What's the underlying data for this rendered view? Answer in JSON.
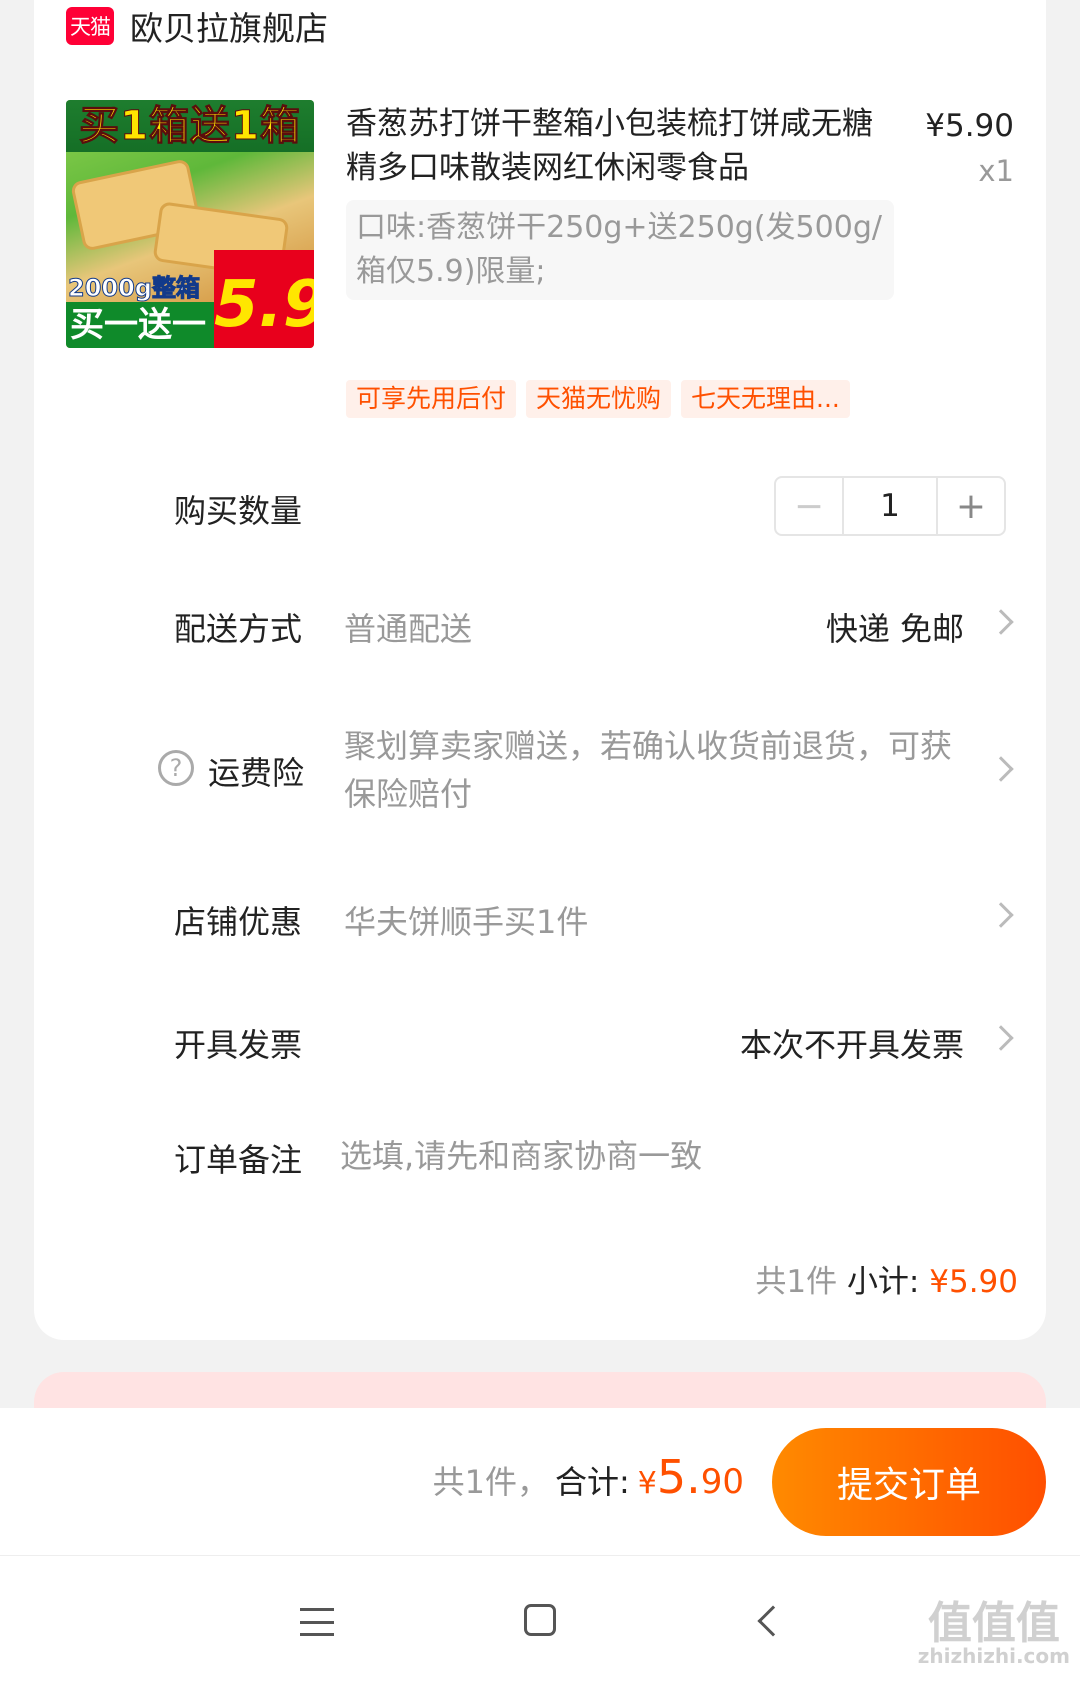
{
  "store": {
    "badge": "天猫",
    "name": "欧贝拉旗舰店"
  },
  "product": {
    "image_banner": "买1箱送1箱",
    "image_weight": "2000g整箱",
    "image_promo": "买一送一",
    "image_price": "5.9",
    "title": "香葱苏打饼干整箱小包装梳打饼咸无糖精多口味散装网红休闲零食品",
    "price": "¥5.90",
    "qty": "x1",
    "sku": "口味:香葱饼干250g+送250g(发500g/箱仅5.9)限量;",
    "tags": [
      "可享先用后付",
      "天猫无忧购",
      "七天无理由..."
    ]
  },
  "quantity": {
    "label": "购买数量",
    "minus": "−",
    "value": "1",
    "plus": "+"
  },
  "delivery": {
    "label": "配送方式",
    "method": "普通配送",
    "detail": "快递 免邮"
  },
  "insurance": {
    "label": "运费险",
    "text": "聚划算卖家赠送，若确认收货前退货，可获保险赔付"
  },
  "discount": {
    "label": "店铺优惠",
    "value": "华夫饼顺手买1件"
  },
  "invoice": {
    "label": "开具发票",
    "value": "本次不开具发票"
  },
  "remark": {
    "label": "订单备注",
    "placeholder": "选填,请先和商家协商一致"
  },
  "subtotal": {
    "count": "共1件",
    "label": "小计:",
    "amount": "¥5.90"
  },
  "footer": {
    "count": "共1件，",
    "label": "合计:",
    "currency": "¥",
    "amount_int": "5.",
    "amount_dec": "90",
    "submit": "提交订单"
  },
  "watermark": {
    "main": "值值值",
    "sub": "zhizhizhi.com"
  },
  "colors": {
    "accent": "#ff5000",
    "tmall_red": "#ff0036",
    "muted": "#999999"
  }
}
